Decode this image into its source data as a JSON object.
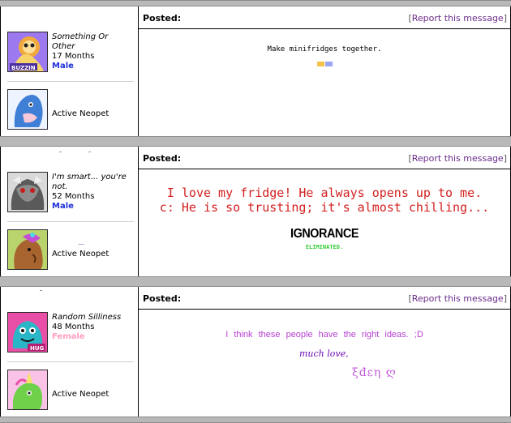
{
  "post_header": {
    "posted_label": "Posted:",
    "report_label": "Report this message"
  },
  "posts": [
    {
      "signature": "Something Or Other",
      "months": "17 Months",
      "gender": "Male",
      "avatar_badge": "BUZZIN",
      "pet_label": "Active Neopet",
      "message": {
        "line1": "Make minifridges together."
      }
    },
    {
      "signature": "I'm smart... you're not.",
      "months": "52 Months",
      "gender": "Male",
      "pet_label": "Active Neopet",
      "message": {
        "line1": "I love my fridge! He always opens up to me.",
        "line2": "c: He is so trusting; it's almost chilling...",
        "sig_big": "IGNORANCE",
        "sig_small": "ELIMINATED."
      }
    },
    {
      "signature": "Random Silliness",
      "months": "48 Months",
      "gender": "Female",
      "avatar_badge": "HUG",
      "pet_label": "Active Neopet",
      "message": {
        "line1": "I think these people have the right ideas. ;D",
        "line2": "much love,",
        "line3": "ξđεη ღ"
      }
    }
  ],
  "colors": {
    "separator": "#b8b8b8",
    "male": "#1c2fd8",
    "female": "#ff9ec4",
    "report_link": "#6b2d8b",
    "post2_text": "#d42020",
    "post2_green": "#33cc33",
    "post3_text": "#b63fd1",
    "post3_script": "#6a0bb0"
  }
}
